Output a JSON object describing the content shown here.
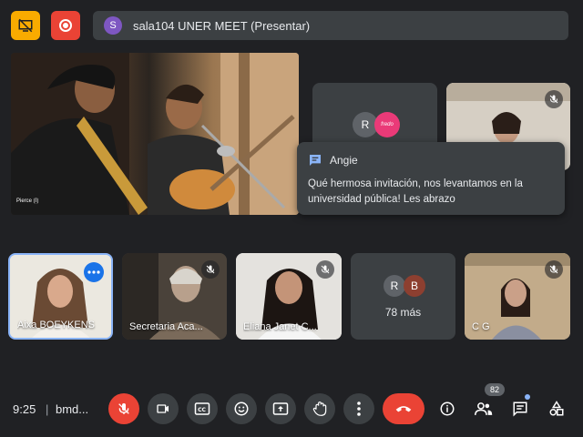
{
  "meeting": {
    "title": "sala104 UNER MEET (Presentar)",
    "avatar_letter": "S"
  },
  "presentation": {
    "label": "Pierce (I)"
  },
  "top_tiles": [
    {
      "avatar_letter": "R",
      "avatar_color": "#5f6368",
      "logo_text": "fredo"
    },
    {
      "muted": true
    }
  ],
  "chat_popup": {
    "sender": "Angie",
    "message": "Qué hermosa invitación, nos levantamos en la universidad pública! Les abrazo"
  },
  "participants": [
    {
      "name": "Aixa BOEYKENS",
      "active": true
    },
    {
      "name": "Secretaria Aca...",
      "muted": true
    },
    {
      "name": "Eliana Janet C...",
      "muted": true
    },
    {
      "avatar_letters": [
        "R",
        "B"
      ],
      "more_label": "78 más"
    },
    {
      "name": "C G",
      "muted": true
    }
  ],
  "bottom_bar": {
    "time": "9:25",
    "separator": "|",
    "meeting_code": "bmd...",
    "participants_count": "82"
  },
  "colors": {
    "accent_red": "#ea4335",
    "accent_yellow": "#f9ab00",
    "active_border": "#8ab4f8",
    "button_gray": "#3c4043"
  }
}
